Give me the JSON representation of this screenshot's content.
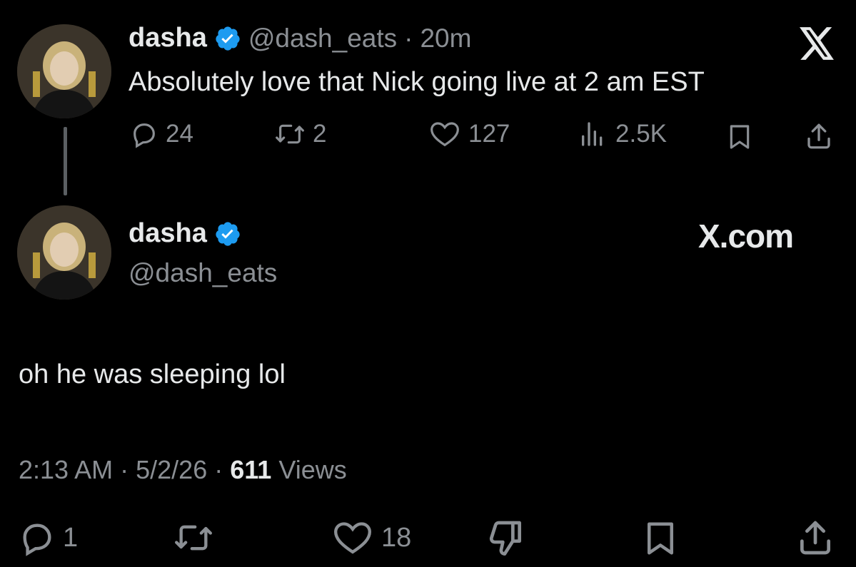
{
  "quoted_tweet": {
    "display_name": "dasha",
    "handle": "@dash_eats",
    "separator": "·",
    "time": "20m",
    "text": "Absolutely love that Nick going live at 2 am EST",
    "replies": "24",
    "reposts": "2",
    "likes": "127",
    "views": "2.5K",
    "icons": [
      "reply-icon",
      "repost-icon",
      "like-icon",
      "views-icon",
      "bookmark-icon",
      "share-icon",
      "x-logo-icon"
    ]
  },
  "reply_tweet": {
    "display_name": "dasha",
    "handle": "@dash_eats",
    "source": "X.com",
    "text": "oh he was sleeping lol",
    "time": "2:13 AM",
    "sep1": "·",
    "date": "5/2/26",
    "sep2": "·",
    "views_count": "611",
    "views_label": "Views",
    "replies": "1",
    "likes": "18",
    "icons": [
      "reply-icon",
      "repost-icon",
      "like-icon",
      "dislike-icon",
      "bookmark-icon",
      "share-icon"
    ]
  },
  "colors": {
    "background": "#000000",
    "text": "#e7e9ea",
    "muted": "#8b8f94",
    "verified": "#1d9bf0"
  }
}
